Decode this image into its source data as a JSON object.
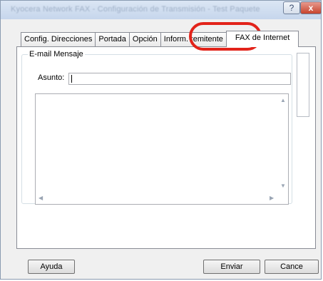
{
  "window": {
    "title": "Kyocera Network FAX - Configuración de Transmisión - Test Paquete",
    "help_glyph": "?",
    "close_glyph": "x"
  },
  "tabs": [
    {
      "label": "Config. Direcciones",
      "active": false
    },
    {
      "label": "Portada",
      "active": false
    },
    {
      "label": "Opción",
      "active": false
    },
    {
      "label": "Inform. remitente",
      "active": false
    },
    {
      "label": "FAX de Internet",
      "active": true
    }
  ],
  "email_group": {
    "title": "E-mail Mensaje",
    "subject_label": "Asunto:",
    "subject_value": "",
    "message_value": ""
  },
  "buttons": {
    "help": "Ayuda",
    "send": "Enviar",
    "cancel": "Cance"
  },
  "colors": {
    "highlight": "#e2231a"
  }
}
